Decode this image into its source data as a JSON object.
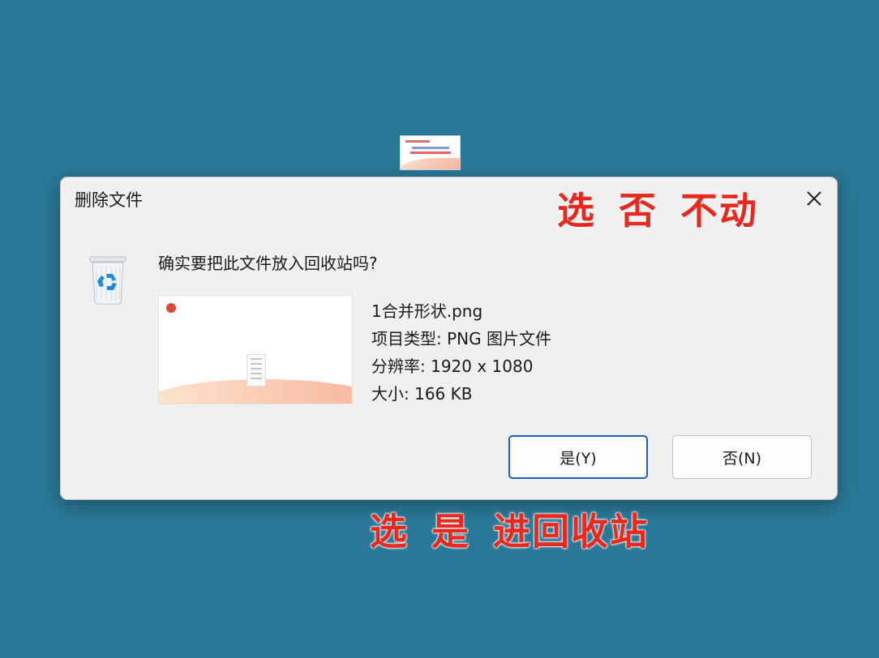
{
  "desktop": {
    "thumbnail_icon": "png-file-thumbnail"
  },
  "dialog": {
    "title": "删除文件",
    "close_icon": "close-icon",
    "recycle_bin_icon": "recycle-bin-icon",
    "question": "确实要把此文件放入回收站吗?",
    "file": {
      "name": "1合并形状.png",
      "type": "项目类型: PNG 图片文件",
      "resolution": "分辨率: 1920 x 1080",
      "size": "大小: 166 KB"
    },
    "buttons": {
      "yes": "是(Y)",
      "no": "否(N)"
    }
  },
  "annotations": {
    "no_note": "选 否 不动",
    "yes_note": "选 是 进回收站",
    "color": "#e8291f"
  }
}
